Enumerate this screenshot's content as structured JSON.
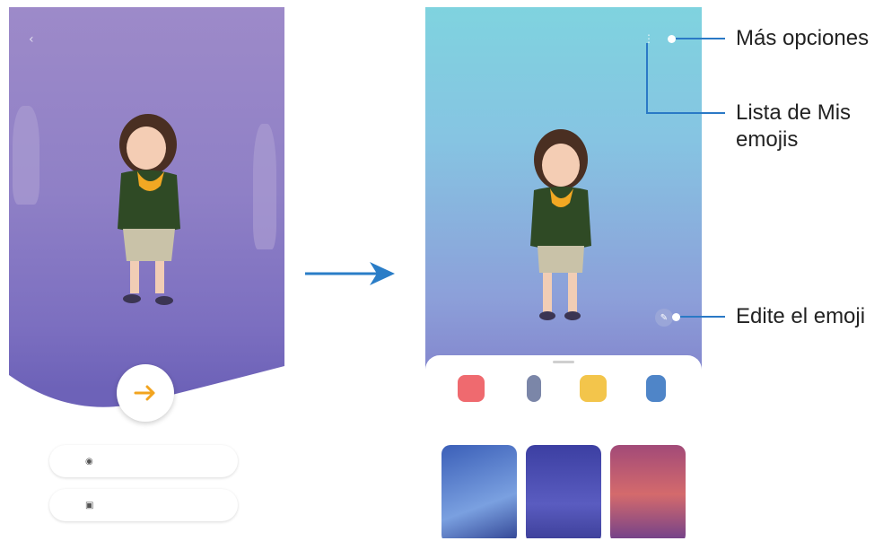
{
  "callouts": {
    "more_options": "Más opciones",
    "my_emoji_list_line1": "Lista de Mis",
    "my_emoji_list_line2": "emojis",
    "edit_emoji": "Edite el emoji"
  },
  "left_screen": {
    "back_icon": "back-arrow-icon",
    "caption": "",
    "next_icon": "arrow-right-icon",
    "option1_icon": "camera-icon",
    "option2_icon": "image-icon"
  },
  "transition_arrow_icon": "arrow-right-icon",
  "right_screen": {
    "categories": [
      {
        "icon": "camera-icon",
        "color": "#ef6a6f"
      },
      {
        "icon": "sticker-icon",
        "color": "#7b86a8"
      },
      {
        "icon": "gallery-icon",
        "color": "#f3c54b"
      },
      {
        "icon": "studio-icon",
        "color": "#4f85c8"
      }
    ],
    "more_options_icon": "more-options-icon",
    "edit_icon": "edit-icon"
  },
  "colors": {
    "callout_line": "#2a79c6",
    "left_bg": "#8f80c6",
    "right_bg_top": "#7fd3df",
    "right_bg_bottom": "#7466bf"
  }
}
